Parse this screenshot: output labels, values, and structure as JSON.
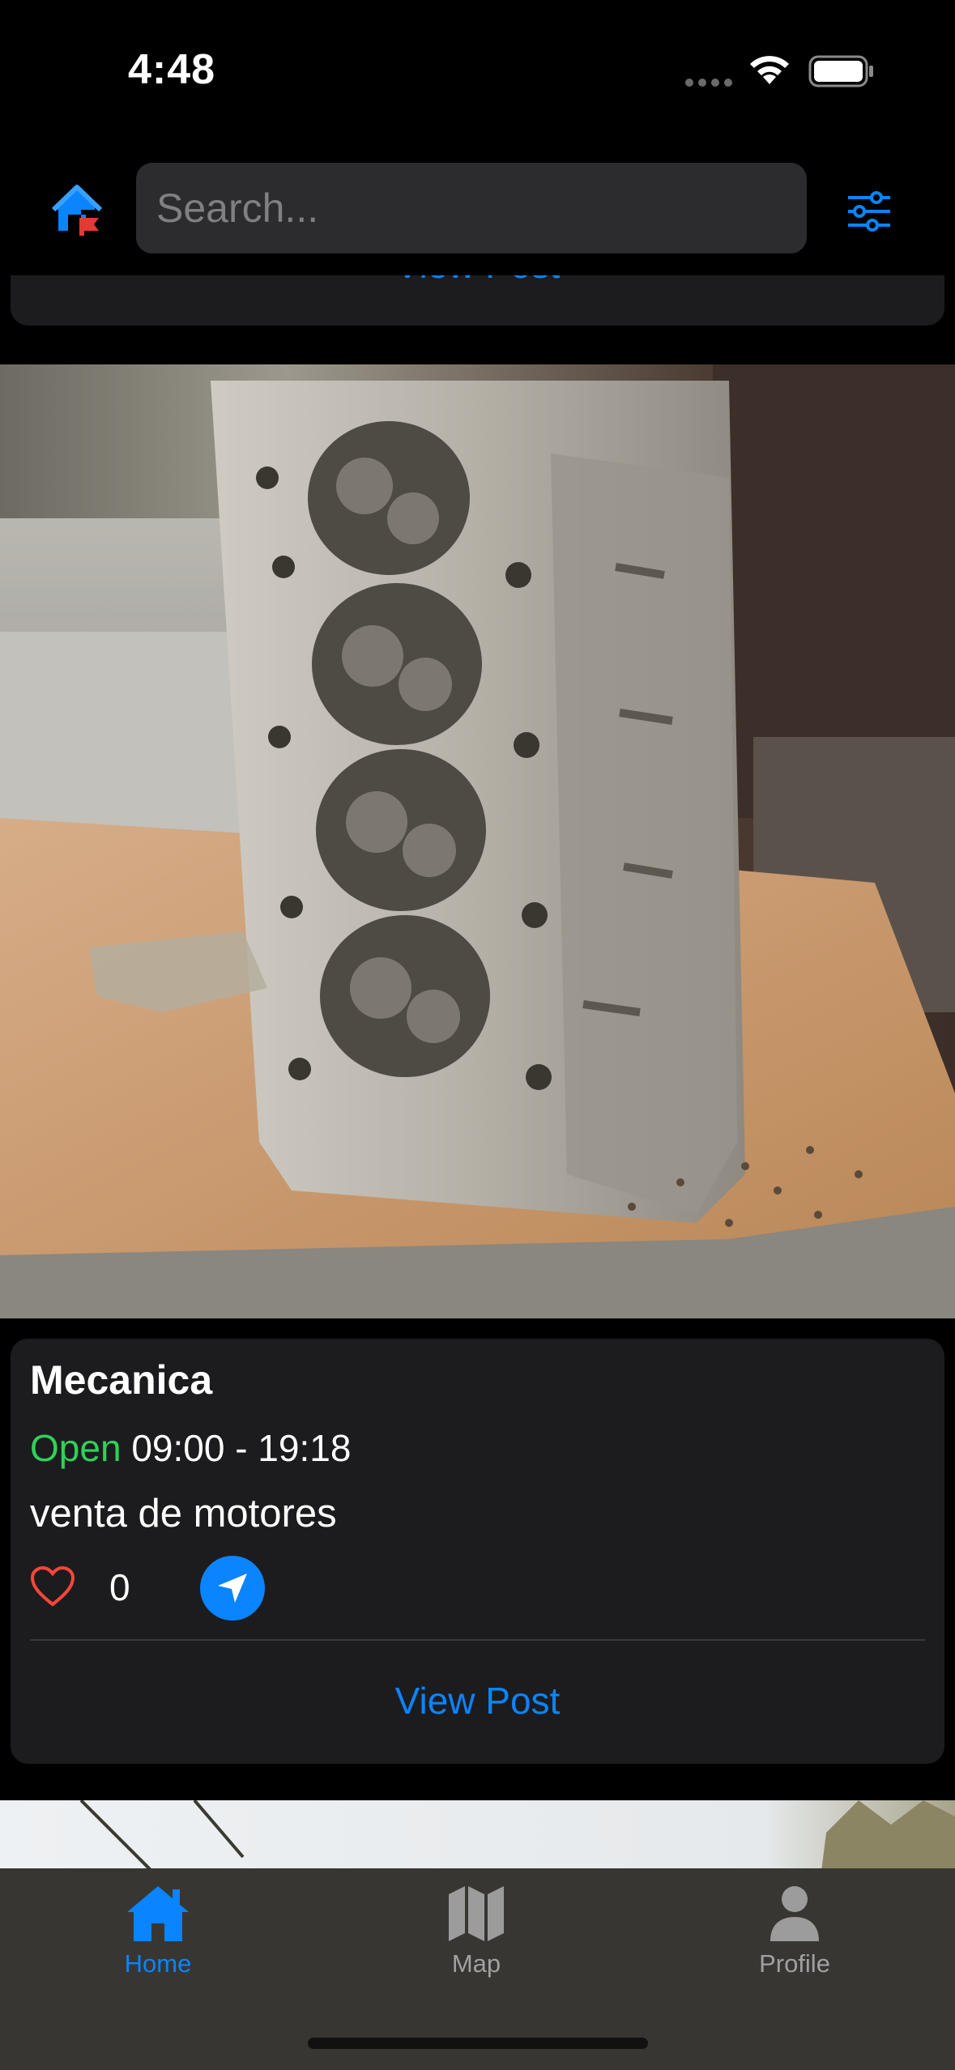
{
  "status_bar": {
    "time": "4:48"
  },
  "search": {
    "placeholder": "Search..."
  },
  "feed": {
    "previous_post": {
      "view_label": "View Post"
    },
    "post": {
      "title": "Mecanica",
      "status": "Open",
      "hours": "09:00 - 19:18",
      "description": "venta de motores",
      "likes": "0",
      "view_label": "View Post"
    }
  },
  "tabbar": {
    "items": [
      {
        "label": "Home",
        "icon": "house-icon",
        "active": true
      },
      {
        "label": "Map",
        "icon": "map-icon",
        "active": false
      },
      {
        "label": "Profile",
        "icon": "person-icon",
        "active": false
      }
    ]
  },
  "colors": {
    "accent": "#0a84ff",
    "open": "#30d158",
    "heart": "#ff453a",
    "card": "#1c1c1e"
  }
}
